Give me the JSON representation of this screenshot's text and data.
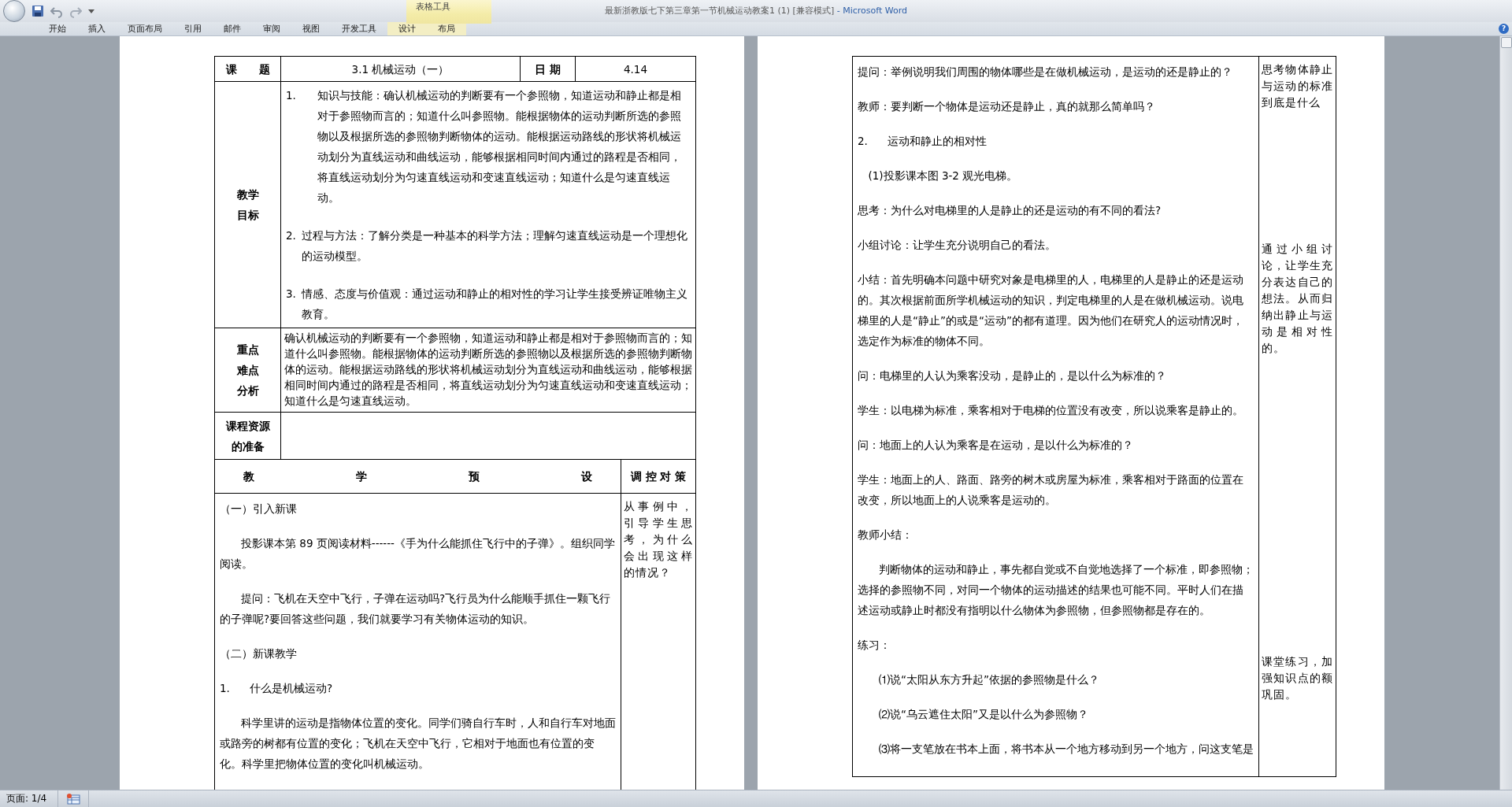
{
  "window": {
    "doc_title": "最新浙教版七下第三章第一节机械运动教案1 (1) [兼容模式]",
    "app_name": "- Microsoft Word"
  },
  "ribbon": {
    "context_group": "表格工具",
    "help": "?",
    "tabs": [
      {
        "label": "开始",
        "contextual": false
      },
      {
        "label": "插入",
        "contextual": false
      },
      {
        "label": "页面布局",
        "contextual": false
      },
      {
        "label": "引用",
        "contextual": false
      },
      {
        "label": "邮件",
        "contextual": false
      },
      {
        "label": "审阅",
        "contextual": false
      },
      {
        "label": "视图",
        "contextual": false
      },
      {
        "label": "开发工具",
        "contextual": false
      },
      {
        "label": "设计",
        "contextual": true
      },
      {
        "label": "布局",
        "contextual": true
      }
    ]
  },
  "left_page": {
    "topic_label": "课　　题",
    "topic": "3.1 机械运动（一）",
    "date_label": "日 期",
    "date": "4.14",
    "goals_label": [
      "教学",
      "目标"
    ],
    "goals": [
      {
        "number": "1.",
        "text": "知识与技能：确认机械运动的判断要有一个参照物，知道运动和静止都是相对于参照物而言的；知道什么叫参照物。能根据物体的运动判断所选的参照物以及根据所选的参照物判断物体的运动。能根据运动路线的形状将机械运动划分为直线运动和曲线运动，能够根据相同时间内通过的路程是否相同，将直线运动划分为匀速直线运动和变速直线运动；知道什么是匀速直线运动。"
      },
      {
        "number": "2.",
        "text": "过程与方法：了解分类是一种基本的科学方法；理解匀速直线运动是一个理想化的运动模型。"
      },
      {
        "number": "3.",
        "text": "情感、态度与价值观：通过运动和静止的相对性的学习让学生接受辨证唯物主义教育。"
      }
    ],
    "key_label": [
      "重点",
      "难点",
      "分析"
    ],
    "key_text": "确认机械运动的判断要有一个参照物，知道运动和静止都是相对于参照物而言的；知道什么叫参照物。能根据物体的运动判断所选的参照物以及根据所选的参照物判断物体的运动。能根据运动路线的形状将机械运动划分为直线运动和曲线运动，能够根据相同时间内通过的路程是否相同，将直线运动划分为匀速直线运动和变速直线运动；知道什么是匀速直线运动。",
    "resources_label": [
      "课程资源",
      "的准备"
    ],
    "plan_header": [
      "教",
      "学",
      "预",
      "设"
    ],
    "strategy_header": "调 控 对 策",
    "plan": [
      {
        "kind": "heading",
        "text": "（一）引入新课"
      },
      {
        "kind": "indent",
        "text": "投影课本第 89 页阅读材料------《手为什么能抓住飞行中的子弹》。组织同学阅读。"
      },
      {
        "kind": "indent",
        "text": "提问：飞机在天空中飞行，子弹在运动吗?飞行员为什么能顺手抓住一颗飞行的子弹呢?要回答这些问题，我们就要学习有关物体运动的知识。"
      },
      {
        "kind": "heading",
        "text": "（二）新课教学"
      },
      {
        "kind": "numbered",
        "number": "1.",
        "text": "什么是机械运动?"
      },
      {
        "kind": "indent",
        "text": "科学里讲的运动是指物体位置的变化。同学们骑自行车时，人和自行车对地面或路旁的树都有位置的变化；飞机在天空中飞行，它相对于地面也有位置的变化。科学里把物体位置的变化叫机械运动。"
      }
    ],
    "notes": [
      "从事例中，引导学生思考，为什么会出现这样的情况？"
    ]
  },
  "right_page": {
    "plan": [
      {
        "kind": "plain",
        "text": "提问：举例说明我们周围的物体哪些是在做机械运动，是运动的还是静止的？"
      },
      {
        "kind": "plain",
        "text": "教师：要判断一个物体是运动还是静止，真的就那么简单吗？"
      },
      {
        "kind": "numbered",
        "number": "2.",
        "text": "运动和静止的相对性"
      },
      {
        "kind": "sub",
        "text": "(1)投影课本图 3-2 观光电梯。"
      },
      {
        "kind": "plain",
        "text": "思考：为什么对电梯里的人是静止的还是运动的有不同的看法?"
      },
      {
        "kind": "plain",
        "text": "小组讨论：让学生充分说明自己的看法。"
      },
      {
        "kind": "plain",
        "text": "小结：首先明确本问题中研究对象是电梯里的人，电梯里的人是静止的还是运动的。其次根据前面所学机械运动的知识，判定电梯里的人是在做机械运动。说电梯里的人是“静止”的或是“运动”的都有道理。因为他们在研究人的运动情况时，选定作为标准的物体不同。"
      },
      {
        "kind": "plain",
        "text": "问：电梯里的人认为乘客没动，是静止的，是以什么为标准的？"
      },
      {
        "kind": "plain",
        "text": "学生：以电梯为标准，乘客相对于电梯的位置没有改变，所以说乘客是静止的。"
      },
      {
        "kind": "plain",
        "text": "问：地面上的人认为乘客是在运动，是以什么为标准的？"
      },
      {
        "kind": "plain",
        "text": "学生：地面上的人、路面、路旁的树木或房屋为标准，乘客相对于路面的位置在改变，所以地面上的人说乘客是运动的。"
      },
      {
        "kind": "plain",
        "text": "教师小结："
      },
      {
        "kind": "indent",
        "text": "判断物体的运动和静止，事先都自觉或不自觉地选择了一个标准，即参照物；选择的参照物不同，对同一个物体的运动描述的结果也可能不同。平时人们在描述运动或静止时都没有指明以什么物体为参照物，但参照物都是存在的。"
      },
      {
        "kind": "plain",
        "text": "练习："
      },
      {
        "kind": "indent",
        "text": "⑴说“太阳从东方升起”依据的参照物是什么？"
      },
      {
        "kind": "indent",
        "text": "⑵说“乌云遮住太阳”又是以什么为参照物？"
      },
      {
        "kind": "indent",
        "text": "⑶将一支笔放在书本上面，将书本从一个地方移动到另一个地方，问这支笔是"
      }
    ],
    "notes": [
      "思考物体静止与运动的标准到底是什么",
      "通过小组讨论，让学生充分表达自己的想法。从而归纳出静止与运动是相对性的。",
      "课堂练习，加强知识点的额巩固。"
    ]
  },
  "status_bar": {
    "page": "页面: 1/4"
  }
}
